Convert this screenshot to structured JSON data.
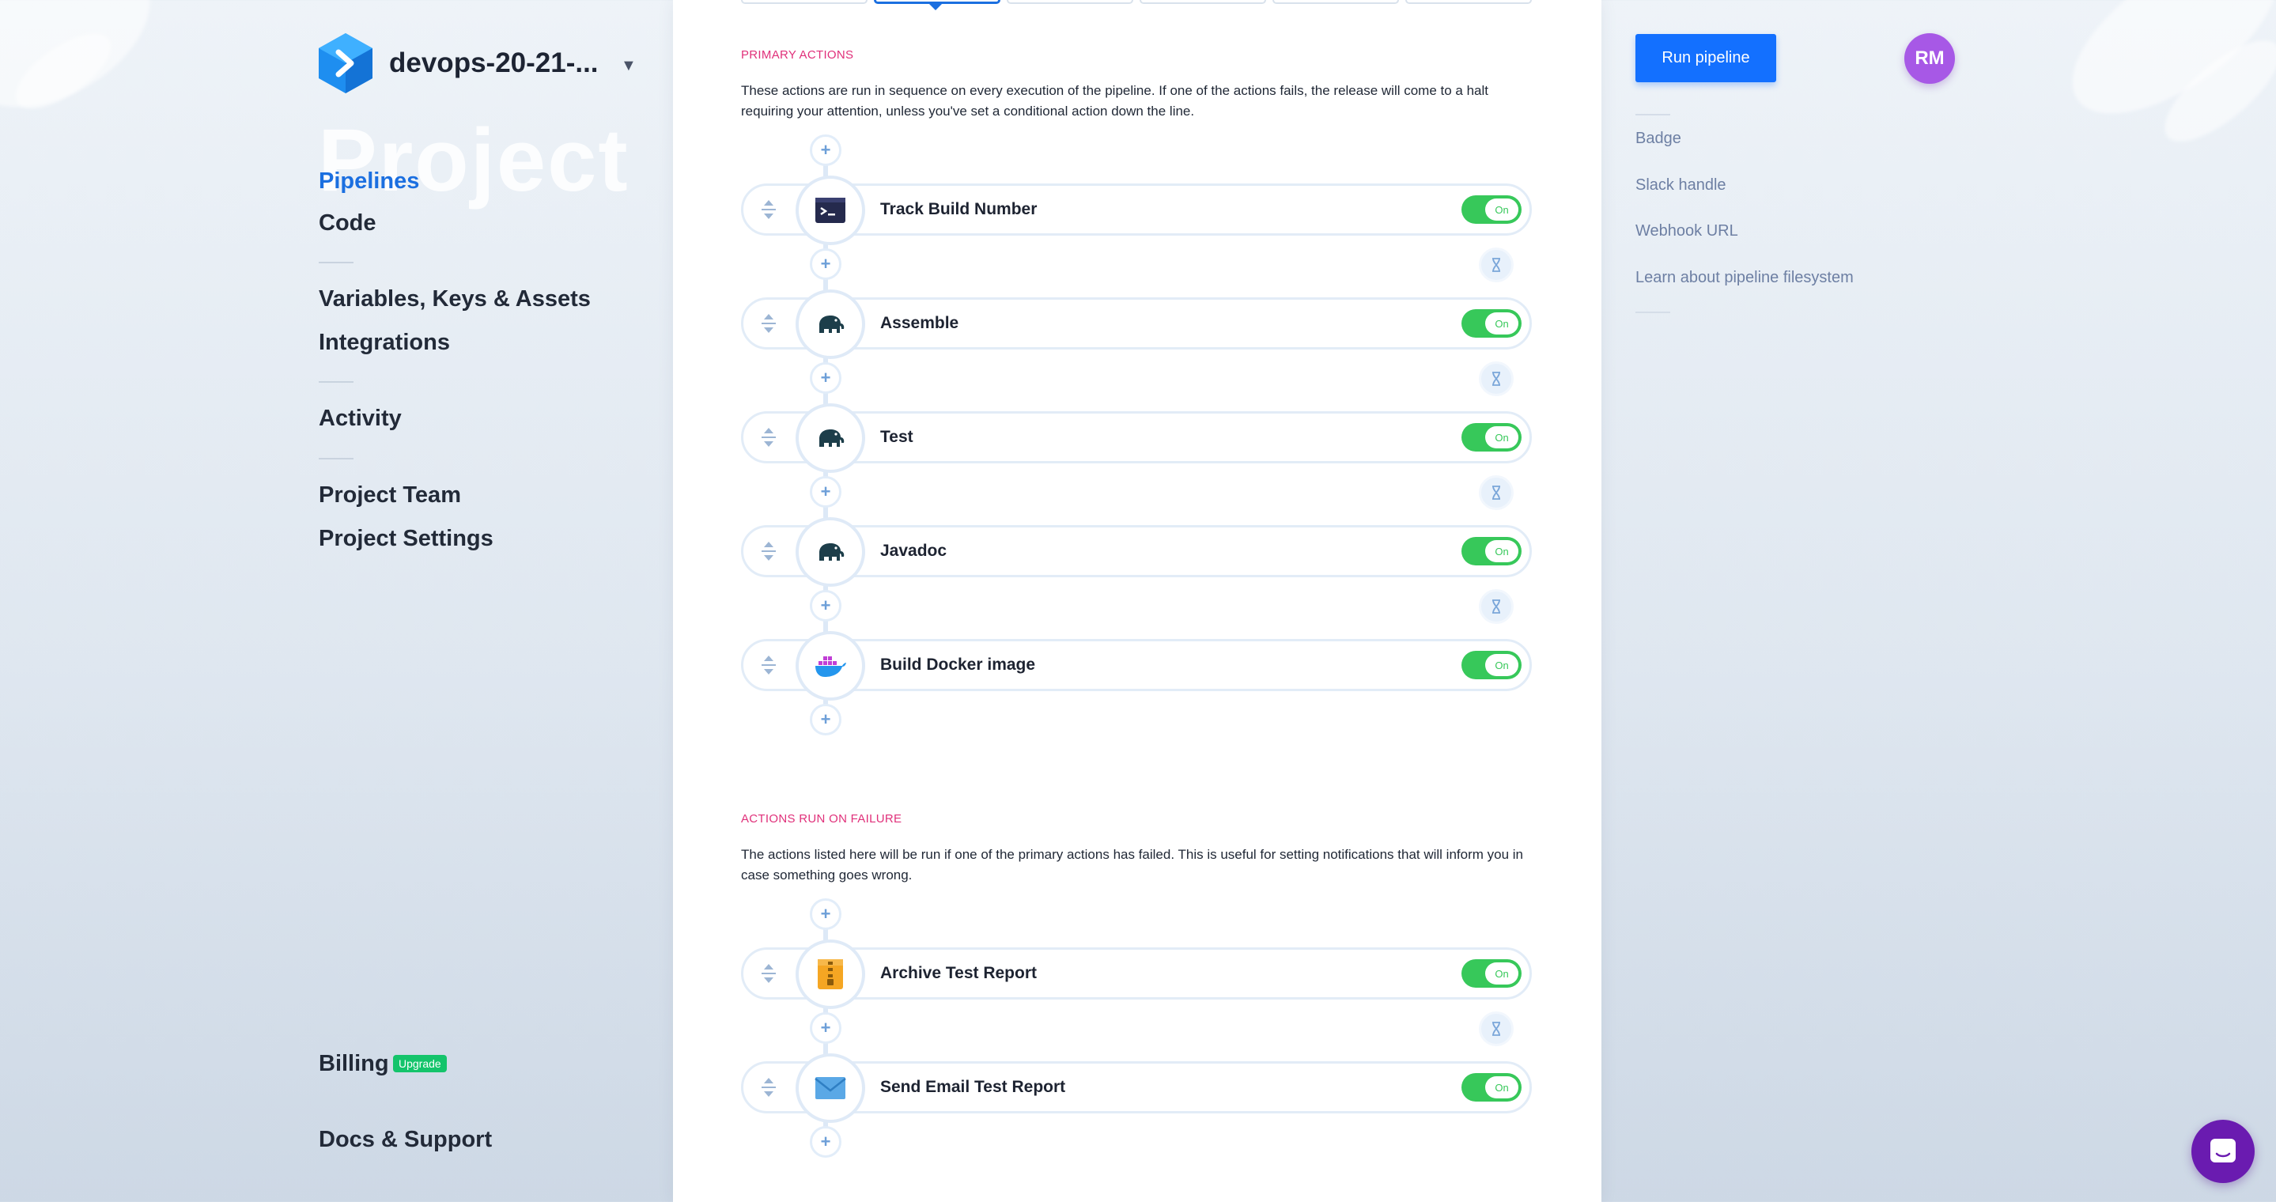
{
  "project": {
    "name": "devops-20-21-...",
    "ghost_title": "Project"
  },
  "sidebar": {
    "items": [
      {
        "label": "Pipelines",
        "active": true
      },
      {
        "label": "Code"
      },
      {
        "label": "Variables, Keys & Assets"
      },
      {
        "label": "Integrations"
      },
      {
        "label": "Activity"
      },
      {
        "label": "Project Team"
      },
      {
        "label": "Project Settings"
      }
    ],
    "billing_label": "Billing",
    "upgrade_badge": "Upgrade",
    "docs_label": "Docs & Support"
  },
  "primary": {
    "label": "PRIMARY ACTIONS",
    "description": "These actions are run in sequence on every execution of the pipeline. If one of the actions fails, the release will come to a halt requiring your attention, unless you've set a conditional action down the line.",
    "actions": [
      {
        "name": "Track Build Number",
        "icon": "terminal-icon",
        "toggle": "On"
      },
      {
        "name": "Assemble",
        "icon": "gradle-elephant-icon",
        "toggle": "On"
      },
      {
        "name": "Test",
        "icon": "gradle-elephant-icon",
        "toggle": "On"
      },
      {
        "name": "Javadoc",
        "icon": "gradle-elephant-icon",
        "toggle": "On"
      },
      {
        "name": "Build Docker image",
        "icon": "docker-whale-icon",
        "toggle": "On"
      }
    ]
  },
  "failure": {
    "label": "ACTIONS RUN ON FAILURE",
    "description": "The actions listed here will be run if one of the primary actions has failed. This is useful for setting notifications that will inform you in case something goes wrong.",
    "actions": [
      {
        "name": "Archive Test Report",
        "icon": "zip-archive-icon",
        "toggle": "On"
      },
      {
        "name": "Send Email Test Report",
        "icon": "envelope-icon",
        "toggle": "On"
      }
    ]
  },
  "right": {
    "run_button": "Run pipeline",
    "avatar_initials": "RM",
    "links": [
      "Badge",
      "Slack handle",
      "Webhook URL",
      "Learn about pipeline filesystem"
    ]
  },
  "colors": {
    "accent": "#1b6fe0",
    "run_button": "#1370ff",
    "section_label": "#e0307a",
    "toggle_on": "#37c85a",
    "avatar": "#a758e6",
    "upgrade_badge": "#14c46b",
    "chat": "#6a1bb0"
  }
}
